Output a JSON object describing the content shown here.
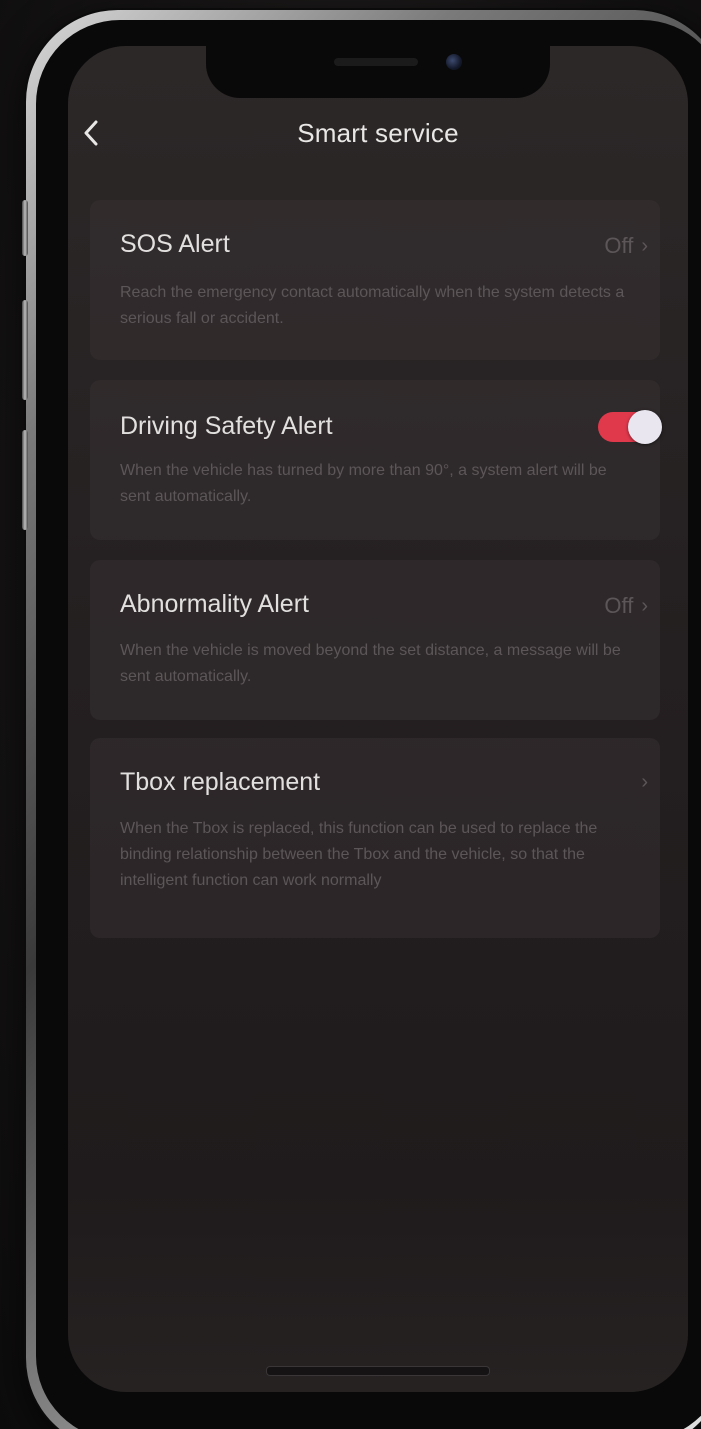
{
  "header": {
    "title": "Smart service",
    "back_icon": "chevron-left-icon"
  },
  "cards": [
    {
      "title": "SOS Alert",
      "status": "Off",
      "description": "Reach the emergency contact automatically when the system detects a serious fall or accident."
    },
    {
      "title": "Driving Safety Alert",
      "toggle_on": true,
      "description": "When the vehicle has turned by more than 90°, a system alert will be sent automatically."
    },
    {
      "title": "Abnormality Alert",
      "status": "Off",
      "description": "When the vehicle is moved beyond the set distance, a message will be sent automatically."
    },
    {
      "title": "Tbox replacement",
      "status": "",
      "description": "When the Tbox is replaced, this function can be used to replace the binding relationship between the Tbox and the vehicle, so that the intelligent function can work normally"
    }
  ],
  "colors": {
    "toggle_active": "#e0394c",
    "title_text": "#e2dfdf",
    "muted_text": "#5c5658"
  }
}
